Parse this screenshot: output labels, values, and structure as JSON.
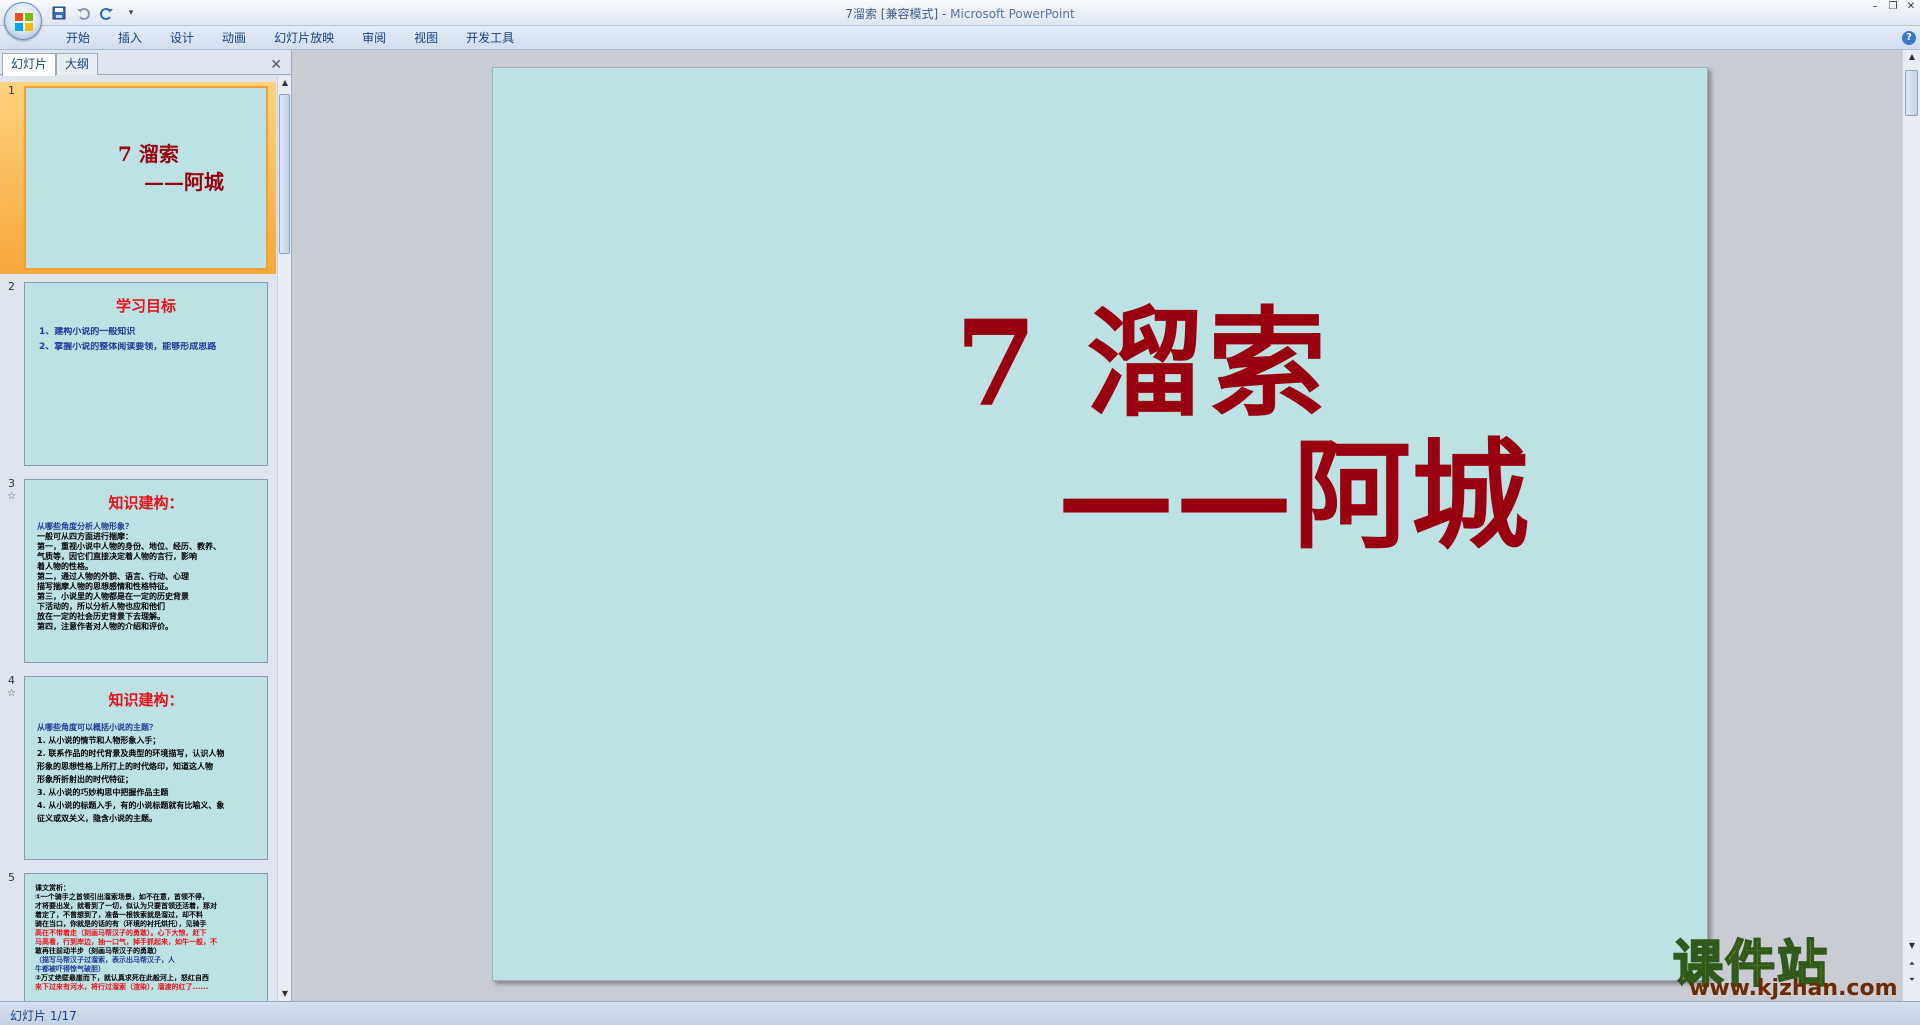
{
  "window": {
    "title": "7溜索 [兼容模式]",
    "app_name": "Microsoft PowerPoint",
    "minimize": "–",
    "restore": "❐",
    "close": "✕"
  },
  "ribbon": {
    "tabs": [
      "开始",
      "插入",
      "设计",
      "动画",
      "幻灯片放映",
      "审阅",
      "视图",
      "开发工具"
    ],
    "help": "?"
  },
  "left_pane": {
    "tabs": [
      "幻灯片",
      "大纲"
    ],
    "close": "✕",
    "slides": [
      {
        "num": "1",
        "title": "7 溜索",
        "subtitle": "——阿城"
      },
      {
        "num": "2",
        "title": "学习目标",
        "lines": [
          "1、建构小说的一般知识",
          "2、掌握小说的整体阅读要领，能够形成思路"
        ]
      },
      {
        "num": "3",
        "star": "☆",
        "title": "知识建构：",
        "lines": [
          "从哪些角度分析人物形象？",
          "一般可从四方面进行揣摩：",
          "第一，重视小说中人物的身份、地位、经历、教养、",
          "   气质等，因它们直接决定着人物的言行，影响",
          "   着人物的性格。",
          "第二，通过人物的外貌、语言、行动、心理",
          "   描写揣摩人物的思想感情和性格特征。",
          "第三，小说里的人物都是在一定的历史背景",
          "   下活动的，所以分析人物也应和他们",
          "   放在一定的社会历史背景下去理解。",
          "第四，注意作者对人物的介绍和评价。"
        ]
      },
      {
        "num": "4",
        "star": "☆",
        "title": "知识建构：",
        "lines": [
          "从哪些角度可以概括小说的主题？",
          "1. 从小说的情节和人物形象入手；",
          "2. 联系作品的时代背景及典型的环境描写，认识人物",
          "   形象的思想性格上所打上的时代烙印，知道这人物",
          "   形象所折射出的时代特征；",
          "3. 从小说的巧妙构思中把握作品主题",
          "4. 从小说的标题入手，有的小说标题就有比喻义、象",
          "   征义或双关义，隐含小说的主题。"
        ]
      },
      {
        "num": "5",
        "lines": [
          "课文赏析：",
          "  ①一个骑手之首领引出溜索场景，如不在意，首领不停，",
          "才将要出发，就看到了一切，似认为只要首领还活着，那对",
          "着定了，不曾想到了，准备一根铁索就是溜过，却不料",
          "骑在当口，你就是的话的有（环境的衬托烘托），见骑手",
          "高在不带着走（刻画马帮汉子的勇敢）。心下大惊，赶下",
          "马高看，行到岸边，抽一口气，掉手抓起来，如牛一般，不",
          "敢再往前动半步（刻画马帮汉子的勇敢）",
          "（描写马帮汉子过溜索，表示出马帮汉子，人",
          "牛都被吓得惊气破胆）",
          "  ②万丈绝壁悬崖而下，就认真求死在此般河上，怒红自西",
          "来下过来有河水，将行过溜索（渲染），溜渡的红了......"
        ]
      }
    ]
  },
  "slide": {
    "title": "7 溜索",
    "subtitle": "——阿城"
  },
  "watermark": {
    "cn": "课件站",
    "en": "www.kjzhan.com"
  },
  "status": {
    "text": "幻灯片 1/17"
  },
  "colors": {
    "slide_bg": "#bde2e4",
    "title_red": "#990010",
    "thumb_red": "#e8101a",
    "selection": "#f6a73b"
  }
}
